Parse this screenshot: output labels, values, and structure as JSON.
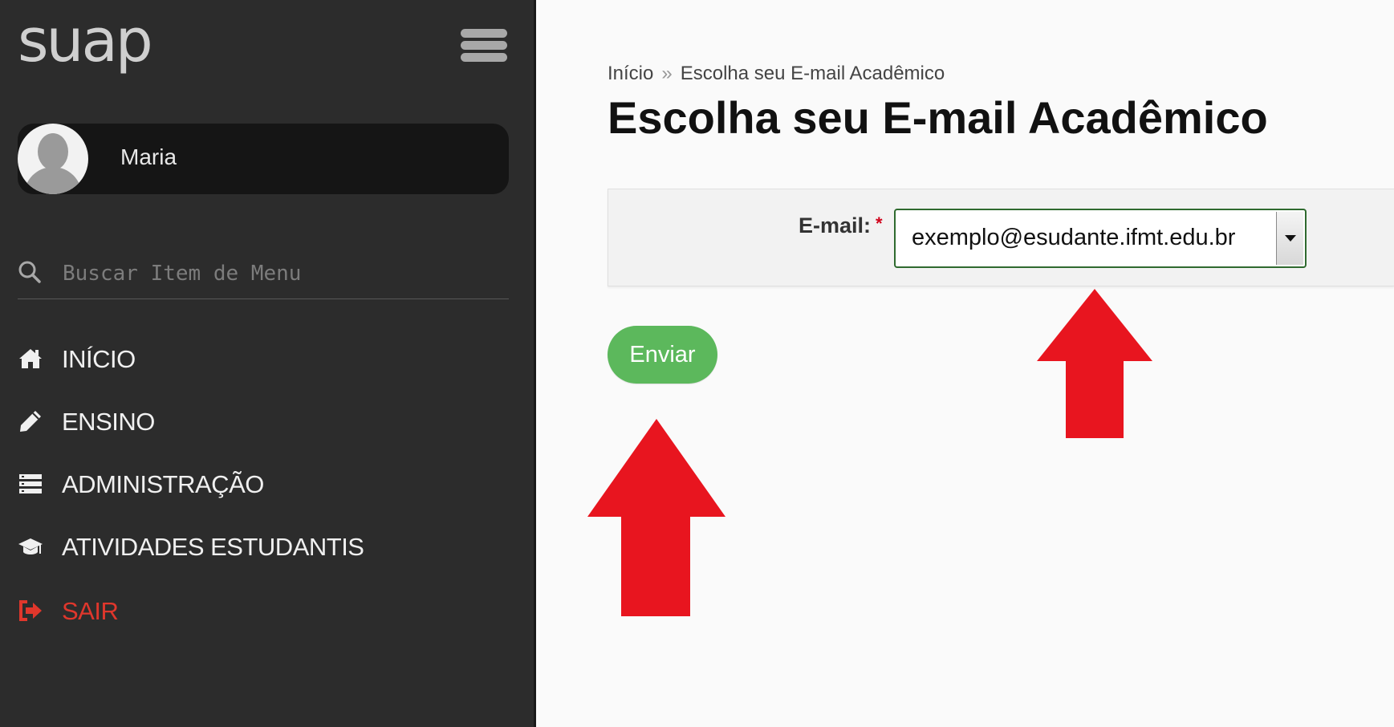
{
  "app": {
    "logo_text": "suap",
    "menu_icon": "hamburger-icon"
  },
  "user": {
    "name": "Maria",
    "avatar_icon": "user-silhouette-icon"
  },
  "search": {
    "placeholder": "Buscar Item de Menu",
    "icon": "search-icon"
  },
  "nav": {
    "items": [
      {
        "label": "INÍCIO",
        "icon": "home-icon"
      },
      {
        "label": "ENSINO",
        "icon": "pencil-icon"
      },
      {
        "label": "ADMINISTRAÇÃO",
        "icon": "list-icon"
      },
      {
        "label": "ATIVIDADES ESTUDANTIS",
        "icon": "graduation-cap-icon"
      },
      {
        "label": "SAIR",
        "icon": "sign-out-icon"
      }
    ]
  },
  "breadcrumb": {
    "home": "Início",
    "separator": "»",
    "current": "Escolha seu E-mail Acadêmico"
  },
  "page": {
    "title": "Escolha seu E-mail Acadêmico"
  },
  "form": {
    "email_label": "E-mail:",
    "required_marker": "*",
    "email_selected": "exemplo@esudante.ifmt.edu.br",
    "submit_label": "Enviar"
  },
  "annotations": {
    "arrow_color": "#e8151f",
    "arrow_icon": "red-up-arrow-icon"
  },
  "colors": {
    "sidebar_bg": "#2c2c2c",
    "accent_green": "#5cb85c",
    "exit_red": "#e0372c"
  }
}
